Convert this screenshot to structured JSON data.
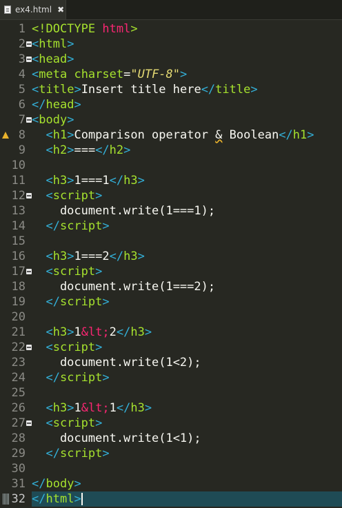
{
  "tab": {
    "title": "ex4.html",
    "icon": "file-icon",
    "close": "✖"
  },
  "editor": {
    "current_line": 32,
    "lines": [
      {
        "num": "1",
        "tokens": [
          [
            "t-doctype-kw",
            "<!DOCTYPE "
          ],
          [
            "t-doctype-html",
            "html"
          ],
          [
            "t-doctype-kw",
            ">"
          ]
        ]
      },
      {
        "num": "2",
        "fold": true,
        "tokens": [
          [
            "t-tag",
            "<"
          ],
          [
            "t-kw",
            "html"
          ],
          [
            "t-tag",
            ">"
          ]
        ]
      },
      {
        "num": "3",
        "fold": true,
        "tokens": [
          [
            "t-tag",
            "<"
          ],
          [
            "t-kw",
            "head"
          ],
          [
            "t-tag",
            ">"
          ]
        ]
      },
      {
        "num": "4",
        "tokens": [
          [
            "t-tag",
            "<"
          ],
          [
            "t-kw",
            "meta"
          ],
          [
            "t-text",
            " "
          ],
          [
            "t-attr",
            "charset"
          ],
          [
            "t-text",
            "="
          ],
          [
            "t-str",
            "\"UTF-8\""
          ],
          [
            "t-tag",
            ">"
          ]
        ]
      },
      {
        "num": "5",
        "tokens": [
          [
            "t-tag",
            "<"
          ],
          [
            "t-kw",
            "title"
          ],
          [
            "t-tag",
            ">"
          ],
          [
            "t-text",
            "Insert title here"
          ],
          [
            "t-tag",
            "</"
          ],
          [
            "t-kw",
            "title"
          ],
          [
            "t-tag",
            ">"
          ]
        ]
      },
      {
        "num": "6",
        "tokens": [
          [
            "t-tag",
            "</"
          ],
          [
            "t-kw",
            "head"
          ],
          [
            "t-tag",
            ">"
          ]
        ]
      },
      {
        "num": "7",
        "fold": true,
        "tokens": [
          [
            "t-tag",
            "<"
          ],
          [
            "t-kw",
            "body"
          ],
          [
            "t-tag",
            ">"
          ]
        ]
      },
      {
        "num": "8",
        "warn": true,
        "tokens": [
          [
            "t-text",
            "  "
          ],
          [
            "t-tag",
            "<"
          ],
          [
            "t-kw",
            "h1"
          ],
          [
            "t-tag",
            ">"
          ],
          [
            "t-text",
            "Comparison operator "
          ],
          [
            "t-text u",
            "&"
          ],
          [
            "t-text",
            " Boolean"
          ],
          [
            "t-tag",
            "</"
          ],
          [
            "t-kw",
            "h1"
          ],
          [
            "t-tag",
            ">"
          ]
        ]
      },
      {
        "num": "9",
        "tokens": [
          [
            "t-text",
            "  "
          ],
          [
            "t-tag",
            "<"
          ],
          [
            "t-kw",
            "h2"
          ],
          [
            "t-tag",
            ">"
          ],
          [
            "t-text",
            "==="
          ],
          [
            "t-tag",
            "</"
          ],
          [
            "t-kw",
            "h2"
          ],
          [
            "t-tag",
            ">"
          ]
        ]
      },
      {
        "num": "10",
        "tokens": []
      },
      {
        "num": "11",
        "tokens": [
          [
            "t-text",
            "  "
          ],
          [
            "t-tag",
            "<"
          ],
          [
            "t-kw",
            "h3"
          ],
          [
            "t-tag",
            ">"
          ],
          [
            "t-text",
            "1===1"
          ],
          [
            "t-tag",
            "</"
          ],
          [
            "t-kw",
            "h3"
          ],
          [
            "t-tag",
            ">"
          ]
        ]
      },
      {
        "num": "12",
        "fold": true,
        "tokens": [
          [
            "t-text",
            "  "
          ],
          [
            "t-tag",
            "<"
          ],
          [
            "t-kw",
            "script"
          ],
          [
            "t-tag",
            ">"
          ]
        ]
      },
      {
        "num": "13",
        "tokens": [
          [
            "t-text",
            "    document.write(1===1);"
          ]
        ]
      },
      {
        "num": "14",
        "tokens": [
          [
            "t-text",
            "  "
          ],
          [
            "t-tag",
            "</"
          ],
          [
            "t-kw",
            "script"
          ],
          [
            "t-tag",
            ">"
          ]
        ]
      },
      {
        "num": "15",
        "tokens": []
      },
      {
        "num": "16",
        "tokens": [
          [
            "t-text",
            "  "
          ],
          [
            "t-tag",
            "<"
          ],
          [
            "t-kw",
            "h3"
          ],
          [
            "t-tag",
            ">"
          ],
          [
            "t-text",
            "1===2"
          ],
          [
            "t-tag",
            "</"
          ],
          [
            "t-kw",
            "h3"
          ],
          [
            "t-tag",
            ">"
          ]
        ]
      },
      {
        "num": "17",
        "fold": true,
        "tokens": [
          [
            "t-text",
            "  "
          ],
          [
            "t-tag",
            "<"
          ],
          [
            "t-kw",
            "script"
          ],
          [
            "t-tag",
            ">"
          ]
        ]
      },
      {
        "num": "18",
        "tokens": [
          [
            "t-text",
            "    document.write(1===2);"
          ]
        ]
      },
      {
        "num": "19",
        "tokens": [
          [
            "t-text",
            "  "
          ],
          [
            "t-tag",
            "</"
          ],
          [
            "t-kw",
            "script"
          ],
          [
            "t-tag",
            ">"
          ]
        ]
      },
      {
        "num": "20",
        "tokens": []
      },
      {
        "num": "21",
        "tokens": [
          [
            "t-text",
            "  "
          ],
          [
            "t-tag",
            "<"
          ],
          [
            "t-kw",
            "h3"
          ],
          [
            "t-tag",
            ">"
          ],
          [
            "t-text",
            "1"
          ],
          [
            "t-ent",
            "&lt;"
          ],
          [
            "t-text",
            "2"
          ],
          [
            "t-tag",
            "</"
          ],
          [
            "t-kw",
            "h3"
          ],
          [
            "t-tag",
            ">"
          ]
        ]
      },
      {
        "num": "22",
        "fold": true,
        "tokens": [
          [
            "t-text",
            "  "
          ],
          [
            "t-tag",
            "<"
          ],
          [
            "t-kw",
            "script"
          ],
          [
            "t-tag",
            ">"
          ]
        ]
      },
      {
        "num": "23",
        "tokens": [
          [
            "t-text",
            "    document.write(1<2);"
          ]
        ]
      },
      {
        "num": "24",
        "tokens": [
          [
            "t-text",
            "  "
          ],
          [
            "t-tag",
            "</"
          ],
          [
            "t-kw",
            "script"
          ],
          [
            "t-tag",
            ">"
          ]
        ]
      },
      {
        "num": "25",
        "tokens": []
      },
      {
        "num": "26",
        "tokens": [
          [
            "t-text",
            "  "
          ],
          [
            "t-tag",
            "<"
          ],
          [
            "t-kw",
            "h3"
          ],
          [
            "t-tag",
            ">"
          ],
          [
            "t-text",
            "1"
          ],
          [
            "t-ent",
            "&lt;"
          ],
          [
            "t-text",
            "1"
          ],
          [
            "t-tag",
            "</"
          ],
          [
            "t-kw",
            "h3"
          ],
          [
            "t-tag",
            ">"
          ]
        ]
      },
      {
        "num": "27",
        "fold": true,
        "tokens": [
          [
            "t-text",
            "  "
          ],
          [
            "t-tag",
            "<"
          ],
          [
            "t-kw",
            "script"
          ],
          [
            "t-tag",
            ">"
          ]
        ]
      },
      {
        "num": "28",
        "tokens": [
          [
            "t-text",
            "    document.write(1<1);"
          ]
        ]
      },
      {
        "num": "29",
        "tokens": [
          [
            "t-text",
            "  "
          ],
          [
            "t-tag",
            "</"
          ],
          [
            "t-kw",
            "script"
          ],
          [
            "t-tag",
            ">"
          ]
        ]
      },
      {
        "num": "30",
        "tokens": []
      },
      {
        "num": "31",
        "tokens": [
          [
            "t-tag",
            "</"
          ],
          [
            "t-kw",
            "body"
          ],
          [
            "t-tag",
            ">"
          ]
        ]
      },
      {
        "num": "32",
        "bookmark": true,
        "tokens": [
          [
            "t-tag",
            "</"
          ],
          [
            "t-kw",
            "html"
          ],
          [
            "t-tag",
            ">"
          ]
        ]
      }
    ]
  }
}
